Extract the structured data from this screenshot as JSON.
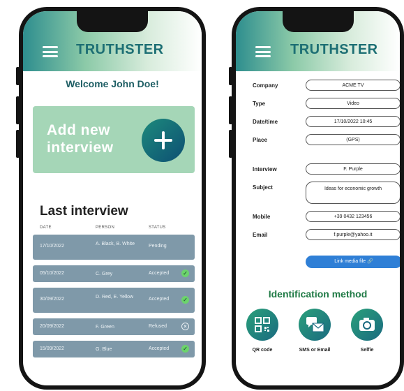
{
  "left_screen": {
    "app_title": "TRUTHSTER",
    "welcome": "Welcome John Doe!",
    "add_interview_label": "Add new interview",
    "last_interview_title": "Last interview",
    "columns": [
      "DATE",
      "PERSON",
      "STATUS"
    ],
    "rows": [
      {
        "date": "17/10/2022",
        "person": "A. Black, B. White",
        "status": "Pending",
        "icon": "none"
      },
      {
        "date": "05/10/2022",
        "person": "C. Grey",
        "status": "Accepted",
        "icon": "check-icon"
      },
      {
        "date": "30/09/2022",
        "person": "D. Red, E. Yellow",
        "status": "Accepted",
        "icon": "check-icon"
      },
      {
        "date": "20/09/2022",
        "person": "F. Green",
        "status": "Refused",
        "icon": "x-circle-icon"
      },
      {
        "date": "15/09/2022",
        "person": "G. Blue",
        "status": "Accepted",
        "icon": "check-icon"
      }
    ]
  },
  "right_screen": {
    "app_title": "TRUTHSTER",
    "fields": [
      {
        "label": "Company",
        "value": "ACME TV"
      },
      {
        "label": "Type",
        "value": "Video"
      },
      {
        "label": "Date/time",
        "value": "17/10/2022 10:45"
      },
      {
        "label": "Place",
        "value": "(GPS)"
      },
      {
        "label": "Interview",
        "value": "F. Purple"
      },
      {
        "label": "Subject",
        "value": "Ideas for economic growth"
      },
      {
        "label": "Mobile",
        "value": "+39 0432 123456"
      },
      {
        "label": "Email",
        "value": "f.purple@yahoo.it"
      }
    ],
    "link_media_label": "Link media file 🔗",
    "identification_title": "Identification method",
    "methods": [
      {
        "label": "QR code",
        "icon": "qr-code-icon"
      },
      {
        "label": "SMS or Email",
        "icon": "message-icon"
      },
      {
        "label": "Selfie",
        "icon": "camera-icon"
      }
    ]
  },
  "colors": {
    "brand": "#1d6f74",
    "card_green": "#a5d6b7",
    "row_slate": "#7f99a9",
    "accepted": "#6cd46c",
    "link_blue": "#2f7fd6",
    "method_green": "#1f7a45"
  }
}
